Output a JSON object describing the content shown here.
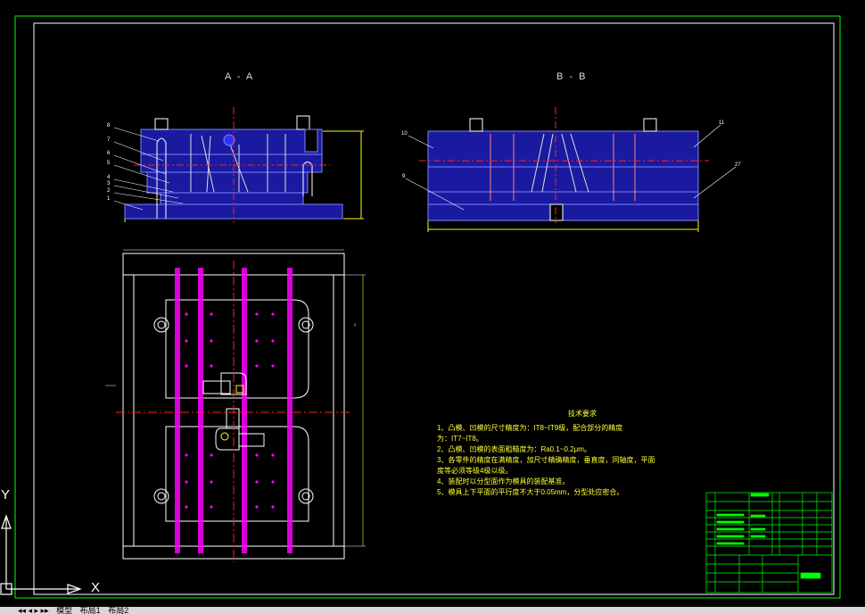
{
  "drawing": {
    "section_aa": "A - A",
    "section_bb": "B - B",
    "notes_title": "技术要求",
    "notes": [
      "1、凸模、凹模的尺寸精度为：IT8~IT9级，配合部分的精度",
      "为：IT7~IT8。",
      "2、凸模、凹模的表面粗糙度为：Ra0.1~0.2μm。",
      "3、各零件的精度在满精度，加尺寸精确精度，垂直度，同轴度，平面",
      "度等必须等级4级以级。",
      "4、装配时以分型面作为模具的装配基准。",
      "5、模具上下平面的平行度不大于0.05mm，分型处应密合。"
    ],
    "leader_labels": [
      "8",
      "7",
      "6",
      "5",
      "4",
      "3",
      "2",
      "1"
    ],
    "bb_labels": {
      "left_top": "10",
      "left_mid": "9",
      "right_top": "11",
      "right_mid": "27"
    }
  },
  "ucs": {
    "x_label": "X",
    "y_label": "Y"
  },
  "tabs": [
    "模型",
    "布局1",
    "布局2"
  ],
  "colors": {
    "background": "#000000",
    "frame": "#ffffff",
    "outer_frame": "#00ff00",
    "mold_fill": "#1a1aa0",
    "mold_edge": "#8080ff",
    "pins": "#ff00ff",
    "centerline": "#ff2020",
    "dimension": "#ffff00",
    "notes": "#ffff33",
    "title_block": "#00ff00"
  }
}
